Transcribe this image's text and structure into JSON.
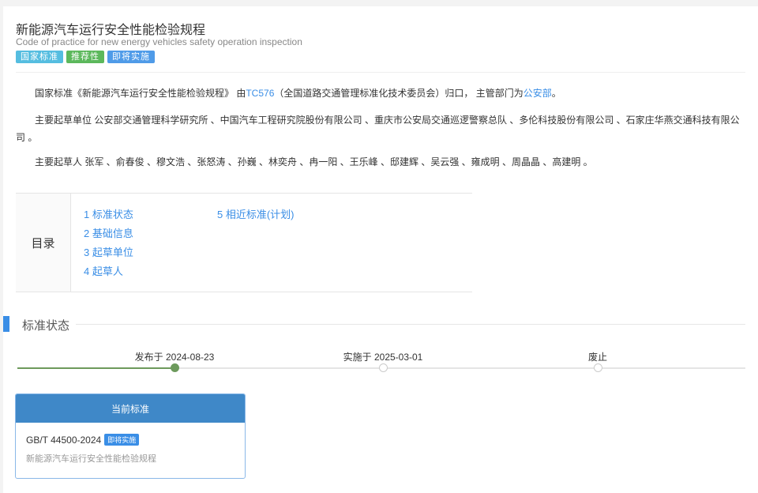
{
  "header": {
    "title": "新能源汽车运行安全性能检验规程",
    "subtitle": "Code of practice for new energy vehicles safety operation inspection",
    "tags": [
      {
        "label": "国家标准",
        "color": "#55bde0"
      },
      {
        "label": "推荐性",
        "color": "#5cb85c"
      },
      {
        "label": "即将实施",
        "color": "#4f9be8"
      }
    ]
  },
  "intro": {
    "p1_a": "国家标准《新能源汽车运行安全性能检验规程》 由",
    "p1_link": "TC576",
    "p1_b": "（全国道路交通管理标准化技术委员会）归口， 主管部门为",
    "p1_link2": "公安部",
    "p1_c": "。",
    "p2": "主要起草单位 公安部交通管理科学研究所 、中国汽车工程研究院股份有限公司 、重庆市公安局交通巡逻警察总队 、多伦科技股份有限公司 、石家庄华燕交通科技有限公司 。",
    "p3": "主要起草人 张军 、俞春俊 、穆文浩 、张怒涛 、孙巍 、林奕舟 、冉一阳 、王乐峰 、邸建辉 、吴云强 、雍成明 、周晶晶 、高建明 。"
  },
  "toc": {
    "label": "目录",
    "items": [
      "1  标准状态",
      "2  基础信息",
      "3  起草单位",
      "4  起草人",
      "5  相近标准(计划)"
    ]
  },
  "status": {
    "title": "标准状态",
    "timeline": [
      {
        "label": "发布于 2024-08-23",
        "done": true
      },
      {
        "label": "实施于 2025-03-01",
        "done": false
      },
      {
        "label": "废止",
        "done": false
      }
    ]
  },
  "card": {
    "header": "当前标准",
    "code": "GB/T 44500-2024",
    "tag": "即将实施",
    "name": "新能源汽车运行安全性能检验规程"
  }
}
